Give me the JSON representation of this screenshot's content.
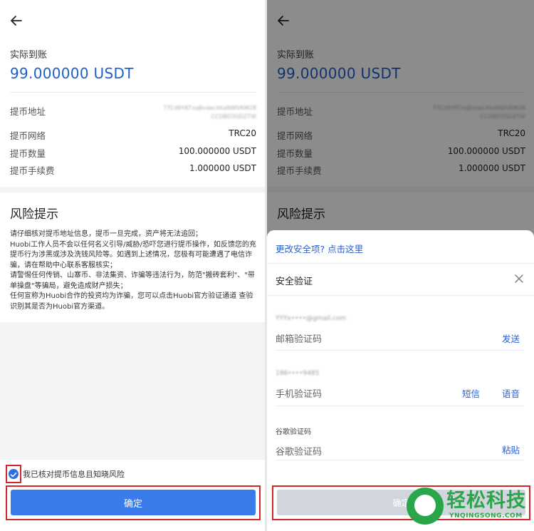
{
  "left": {
    "actual_label": "实际到账",
    "amount": "99.000000 USDT",
    "address_label": "提币地址",
    "address_value": "TTCd9YKTxqBvaecXkaNWVKM28 CCDBD3SDZTW",
    "rows": [
      {
        "key": "提币网络",
        "value": "TRC20"
      },
      {
        "key": "提币数量",
        "value": "100.000000 USDT"
      },
      {
        "key": "提币手续费",
        "value": "1.000000 USDT"
      }
    ],
    "risk_title": "风险提示",
    "risk_text": "请仔细核对提币地址信息，提币一旦完成，资产将无法追回；\nHuobi工作人员不会以任何名义引导/威胁/恐吓您进行提币操作，如反馈您的充提币行为涉黑或涉及洗钱风险等。如遇到上述情况，您极有可能遭遇了电信诈骗，请在帮助中心联系客服核实；\n请警惕任何传销、山寨币、非法集资、诈骗等违法行为，防范\"搬砖套利\"、\"带单操盘\"等骗局，避免造成财产损失；\n任何宣称为Huobi合作的投资均为诈骗，您可以点击Huobi官方验证通道 查验识别其是否为Huobi官方渠道。",
    "check_label": "我已核对提币信息且知晓风险",
    "confirm": "确定"
  },
  "right": {
    "change_security": "更改安全项? 点击这里",
    "security_title": "安全验证",
    "email_mask": "YYYx••••@gmail.com",
    "email_code": "邮箱验证码",
    "send": "发送",
    "phone_mask": "186••••9485",
    "phone_code": "手机验证码",
    "sms": "短信",
    "voice": "语音",
    "google_label": "谷歌验证码",
    "google_placeholder": "谷歌验证码",
    "paste": "粘贴",
    "confirm": "确定"
  },
  "watermark": {
    "text": "轻松科技",
    "sub": "YNQINGSONG.COM"
  },
  "colors": {
    "accent": "#2b5fcc",
    "button": "#3a7bea",
    "highlight": "#d8232a",
    "brand_watermark": "#2aa64a"
  }
}
